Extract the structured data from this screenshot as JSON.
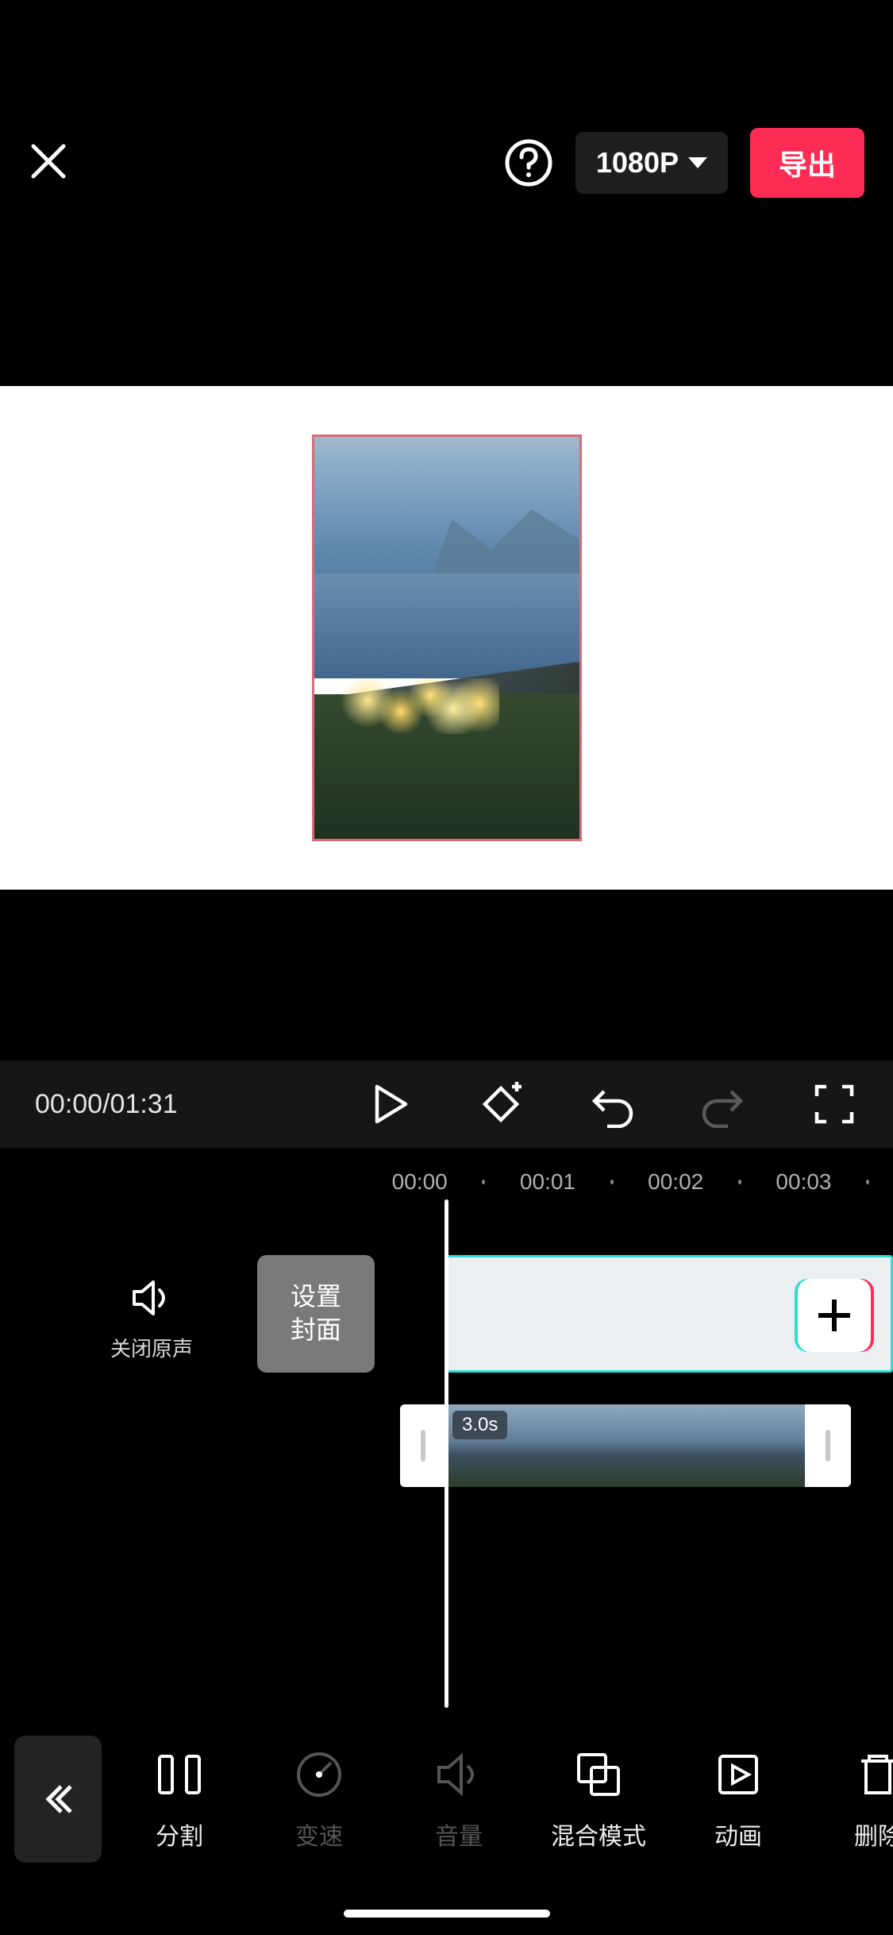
{
  "topbar": {
    "resolution": "1080P",
    "export_label": "导出"
  },
  "transport": {
    "current_time": "00:00",
    "separator": "/",
    "total_time": "01:31"
  },
  "ruler": {
    "marks": [
      "00:00",
      "00:01",
      "00:02",
      "00:03"
    ]
  },
  "timeline": {
    "mute_label": "关闭原声",
    "cover_line1": "设置",
    "cover_line2": "封面",
    "pip_clip_duration": "3.0s"
  },
  "tools": [
    {
      "id": "split",
      "label": "分割",
      "enabled": true,
      "icon": "split"
    },
    {
      "id": "speed",
      "label": "变速",
      "enabled": false,
      "icon": "speed"
    },
    {
      "id": "volume",
      "label": "音量",
      "enabled": false,
      "icon": "volume"
    },
    {
      "id": "blend",
      "label": "混合模式",
      "enabled": true,
      "icon": "blend"
    },
    {
      "id": "anim",
      "label": "动画",
      "enabled": true,
      "icon": "anim"
    },
    {
      "id": "delete",
      "label": "删除",
      "enabled": true,
      "icon": "delete"
    }
  ]
}
